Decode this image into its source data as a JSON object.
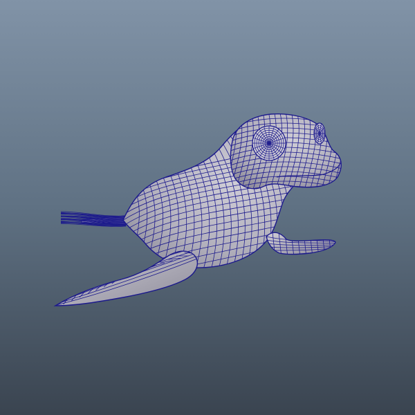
{
  "viewport": {
    "background_top": "#8193a7",
    "background_mid": "#5f7183",
    "background_bottom": "#3a4450",
    "mesh_surface": "#b3b1bd",
    "mesh_surface_light": "#cfcdd6",
    "mesh_surface_dark": "#8d8b99",
    "wireframe_color": "#1c1a8c",
    "render_mode": "wireframe-on-shaded"
  },
  "model": {
    "subject": "seal",
    "parts": [
      "body",
      "head",
      "left-eye",
      "right-eye",
      "snout",
      "front-flipper-left",
      "front-flipper-right",
      "tail-flippers"
    ]
  }
}
